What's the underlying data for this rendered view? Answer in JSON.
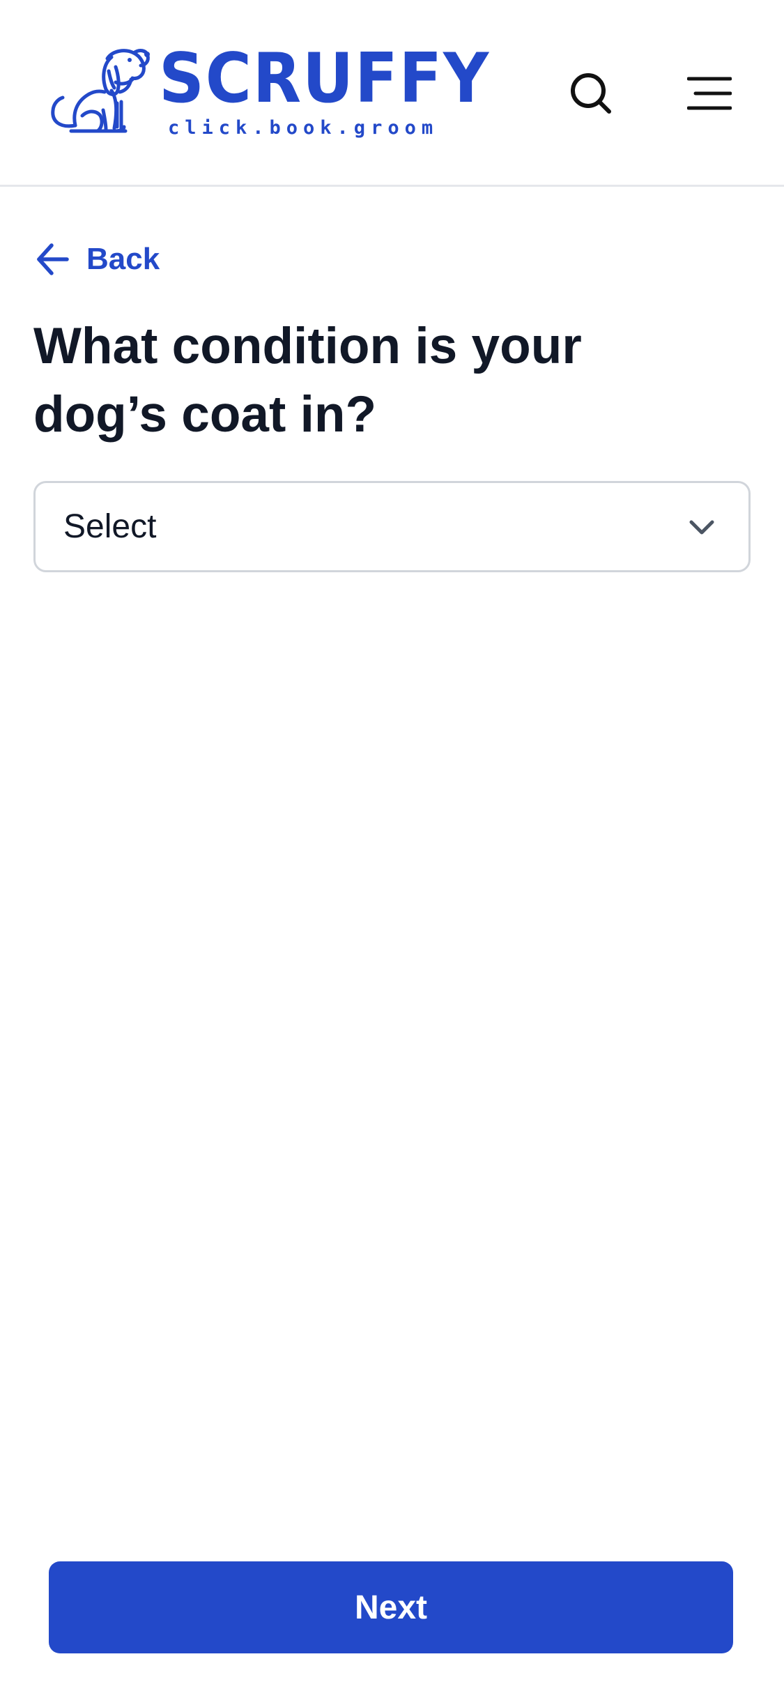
{
  "header": {
    "logo": {
      "wordmark": "SCRUFFY",
      "tagline": "click.book.groom",
      "icon": "dog-logo-icon",
      "color": "#2349c9"
    },
    "search_icon": "search-icon",
    "menu_icon": "hamburger-menu-icon"
  },
  "nav": {
    "back_label": "Back",
    "back_icon": "arrow-left-icon"
  },
  "form": {
    "question": "What condition is your dog’s coat in?",
    "select": {
      "value": "Select",
      "icon": "chevron-down-icon"
    }
  },
  "footer": {
    "next_label": "Next"
  },
  "colors": {
    "brand": "#2349c9",
    "text": "#111827",
    "border": "#d1d5db"
  }
}
